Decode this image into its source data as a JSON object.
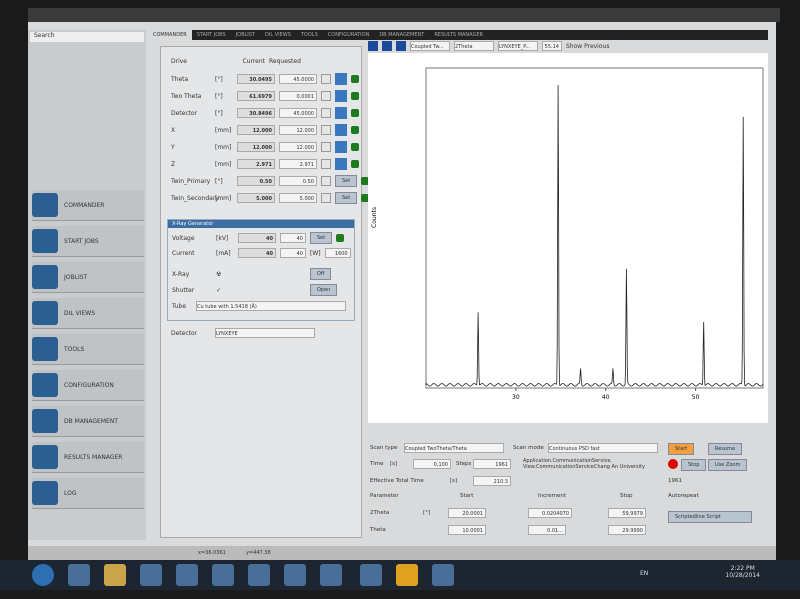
{
  "tabs": [
    "COMMANDER",
    "START JOBS",
    "JOBLIST",
    "DIL VIEWS",
    "TOOLS",
    "CONFIGURATION",
    "DB MANAGEMENT",
    "RESULTS MANAGER"
  ],
  "sidebar": {
    "search": "Search",
    "items": [
      "COMMANDER",
      "START JOBS",
      "JOBLIST",
      "DIL VIEWS",
      "TOOLS",
      "CONFIGURATION",
      "DB MANAGEMENT",
      "RESULTS MANAGER",
      "LOG"
    ]
  },
  "drives": {
    "header": {
      "drive": "Drive",
      "current": "Current",
      "requested": "Requested"
    },
    "rows": [
      {
        "name": "Theta",
        "unit": "[°]",
        "current": "30.0495",
        "requested": "45.0000"
      },
      {
        "name": "Two Theta",
        "unit": "[°]",
        "current": "61.6979",
        "requested": "0.0001"
      },
      {
        "name": "Detector",
        "unit": "[°]",
        "current": "30.8496",
        "requested": "45.0000"
      },
      {
        "name": "X",
        "unit": "[mm]",
        "current": "12.000",
        "requested": "12.000"
      },
      {
        "name": "Y",
        "unit": "[mm]",
        "current": "12.000",
        "requested": "12.000"
      },
      {
        "name": "Z",
        "unit": "[mm]",
        "current": "2.971",
        "requested": "2.971"
      },
      {
        "name": "Twin_Primary",
        "unit": "[°]",
        "current": "0.50",
        "requested": "0.50",
        "btn": "Set"
      },
      {
        "name": "Twin_Secondary",
        "unit": "[mm]",
        "current": "5.000",
        "requested": "5.000",
        "btn": "Set"
      }
    ]
  },
  "xray": {
    "title": "X-Ray Generator",
    "voltage": {
      "label": "Voltage",
      "unit": "[kV]",
      "value": "40",
      "set": "40",
      "btn": "Set"
    },
    "current": {
      "label": "Current",
      "unit": "[mA]",
      "value": "40",
      "set": "40",
      "wunit": "[W]",
      "power": "1600"
    },
    "xray_label": "X-Ray",
    "xray_btn": "Off",
    "shutter_label": "Shutter",
    "shutter_btn": "Open",
    "tube_label": "Tube",
    "tube": "Cu tube with 1.5418 (Å)"
  },
  "detector": {
    "label": "Detector",
    "value": "LYNXEYE"
  },
  "chart_toolbar": {
    "scan": "Coupled Tw...",
    "axis": "2Theta",
    "det": "LYNXEYE_P...",
    "value": "55.14",
    "show_previous": "Show Previous"
  },
  "chart_data": {
    "type": "line",
    "ylabel": "Counts",
    "xticks": [
      30,
      40,
      50
    ],
    "xlim": [
      20,
      57.5
    ],
    "peaks": [
      {
        "x": 25.8,
        "y": 0.23
      },
      {
        "x": 34.7,
        "y": 0.94
      },
      {
        "x": 37.2,
        "y": 0.05
      },
      {
        "x": 40.8,
        "y": 0.05
      },
      {
        "x": 42.3,
        "y": 0.36
      },
      {
        "x": 50.9,
        "y": 0.2
      },
      {
        "x": 55.3,
        "y": 0.84
      }
    ]
  },
  "scan": {
    "scan_type_label": "Scan type",
    "scan_type": "Coupled TwoTheta/Theta",
    "scan_mode_label": "Scan mode",
    "scan_mode": "Continuous PSD fast",
    "start": "Start",
    "resume": "Resume",
    "stop": "Stop",
    "use_zoom": "Use Zoom",
    "time_label": "Time",
    "time_unit": "[s]",
    "time": "0.100",
    "steps_label": "Steps",
    "steps": "1961",
    "eff_label": "Effective Total Time",
    "eff_unit": "[s]",
    "eff": "210.3",
    "message": "Application.CommunicationService. View.CommunicationServiceChang An University",
    "count": "1961",
    "autorepeat": "Autorepeat",
    "param": "Parameter",
    "start_h": "Start",
    "inc_h": "Increment",
    "stop_h": "Stop",
    "p1": {
      "name": "2Theta",
      "unit": "[°]",
      "start": "20.0001",
      "inc": "0.0204070",
      "stop": "59.9979"
    },
    "p2": {
      "name": "Theta",
      "start": "10.0001",
      "inc": "0.01...",
      "stop": "29.9990"
    },
    "script": "Scriptedline Script"
  },
  "status": {
    "x": "x=36.0361",
    "y": "y=447.38"
  },
  "clock": {
    "time": "2:22 PM",
    "date": "10/28/2014",
    "lang": "EN"
  }
}
